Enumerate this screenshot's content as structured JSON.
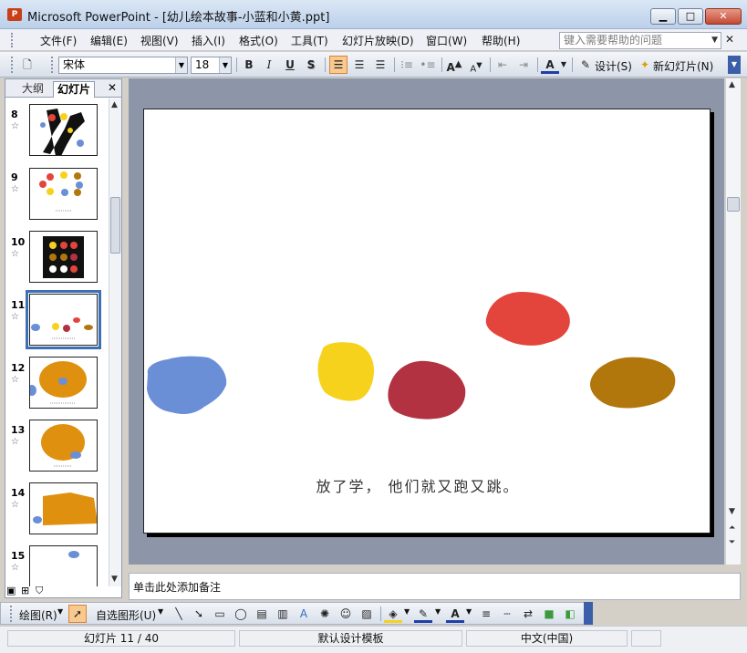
{
  "window": {
    "title": "Microsoft PowerPoint - [幼儿绘本故事-小蓝和小黄.ppt]",
    "min_label": "▁",
    "max_label": "□",
    "close_label": "✕"
  },
  "menu": {
    "items": [
      "文件(F)",
      "编辑(E)",
      "视图(V)",
      "插入(I)",
      "格式(O)",
      "工具(T)",
      "幻灯片放映(D)",
      "窗口(W)",
      "帮助(H)"
    ],
    "help_placeholder": "键入需要帮助的问题"
  },
  "toolbar": {
    "font_name": "宋体",
    "font_size": "18",
    "bold": "B",
    "italic": "I",
    "underline": "U",
    "shadow": "S",
    "design_label": "设计(S)",
    "new_slide_label": "新幻灯片(N)"
  },
  "left_pane": {
    "tab_outline": "大纲",
    "tab_slides": "幻灯片",
    "close": "✕",
    "selected_slide": 11,
    "thumbnails": [
      {
        "num": "8"
      },
      {
        "num": "9"
      },
      {
        "num": "10"
      },
      {
        "num": "11"
      },
      {
        "num": "12"
      },
      {
        "num": "13"
      },
      {
        "num": "14"
      },
      {
        "num": "15"
      }
    ]
  },
  "slide": {
    "caption": "放了学， 他们就又跑又跳。",
    "colors": {
      "blue": "#6a8fd6",
      "yellow": "#f6d21c",
      "red": "#e3443b",
      "crimson": "#b23241",
      "ochre": "#b2770c"
    }
  },
  "notes": {
    "placeholder": "单击此处添加备注"
  },
  "drawbar": {
    "draw_label": "绘图(R)",
    "autoshapes_label": "自选图形(U)"
  },
  "status": {
    "slide_info": "幻灯片 11 / 40",
    "template": "默认设计模板",
    "language": "中文(中国)"
  }
}
